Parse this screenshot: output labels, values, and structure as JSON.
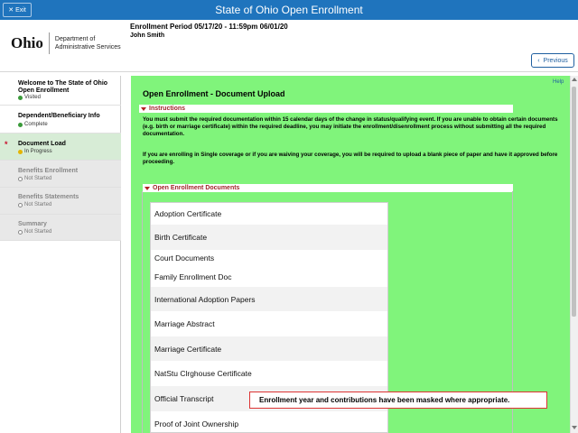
{
  "app": {
    "title": "State of Ohio Open Enrollment",
    "exit_label": "Exit"
  },
  "header": {
    "logo_text": "Ohio",
    "logo_dept_line1": "Department of",
    "logo_dept_line2": "Administrative Services",
    "enrollment_period": "Enrollment Period 05/17/20   - 11:59pm 06/01/20",
    "user_name": "John Smith",
    "previous_label": "Previous"
  },
  "sidebar": {
    "steps": [
      {
        "title": "Welcome to The State of Ohio Open Enrollment",
        "status": "Visited"
      },
      {
        "title": "Dependent/Beneficiary Info",
        "status": "Complete"
      },
      {
        "title": "Document Load",
        "status": "In Progress"
      },
      {
        "title": "Benefits Enrollment",
        "status": "Not Started"
      },
      {
        "title": "Benefits Statements",
        "status": "Not Started"
      },
      {
        "title": "Summary",
        "status": "Not Started"
      }
    ]
  },
  "main": {
    "help_label": "Help",
    "page_title": "Open Enrollment - Document Upload",
    "instructions_label": "Instructions",
    "instructions_p1": "You must submit the required documentation within 15 calendar days of the change in status/qualifying event. If you are unable to obtain certain documents (e.g. birth or marriage certificate) within the required deadline, you may initiate the enrollment/disenrollment process without submitting all the required documentation.",
    "instructions_p2": "If you are enrolling in Single coverage or if you are waiving your coverage, you will be required to upload a blank piece of paper and have it approved before proceeding.",
    "documents_label": "Open Enrollment Documents",
    "documents": [
      "Adoption Certificate",
      "Birth Certificate",
      "Court Documents",
      "Family Enrollment Doc",
      "International Adoption Papers",
      "Marriage Abstract",
      "Marriage Certificate",
      "NatStu Clrghouse Certificate",
      "Official Transcript",
      "Proof of Joint Ownership"
    ]
  },
  "note": "Enrollment year and contributions have been masked where appropriate."
}
